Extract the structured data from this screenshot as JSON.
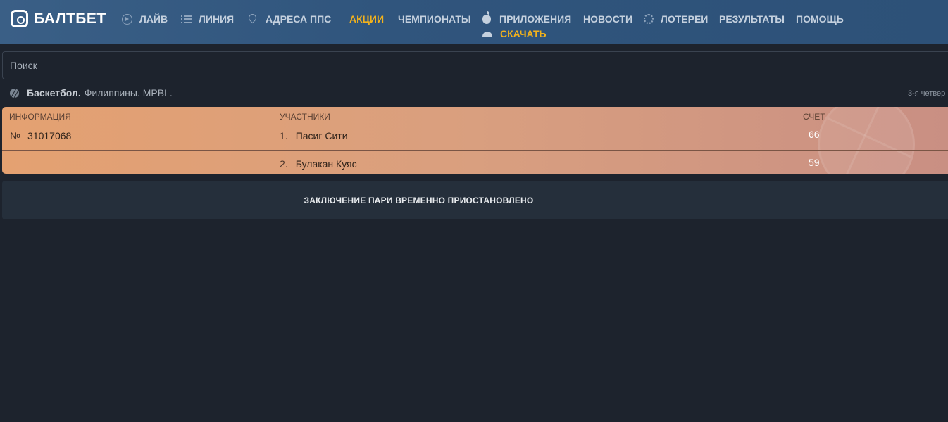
{
  "header": {
    "logo_text": "БАЛТБЕТ",
    "nav": {
      "live": "ЛАЙВ",
      "line": "ЛИНИЯ",
      "addresses": "АДРЕСА ППС",
      "promo": "АКЦИИ",
      "championships": "ЧЕМПИОНАТЫ",
      "apps": "ПРИЛОЖЕНИЯ",
      "download": "СКАЧАТЬ",
      "news": "НОВОСТИ",
      "lotteries": "ЛОТЕРЕИ",
      "results": "РЕЗУЛЬТАТЫ",
      "help": "ПОМОЩЬ"
    },
    "accent_color": "#f2b21c"
  },
  "search": {
    "placeholder": "Поиск",
    "value": ""
  },
  "breadcrumb": {
    "sport": "Баскетбол.",
    "path": "Филиппины. MPBL.",
    "period": "3-я четвер"
  },
  "match": {
    "headers": {
      "info": "ИНФОРМАЦИЯ",
      "participants": "УЧАСТНИКИ",
      "score": "СЧЕТ"
    },
    "number_sign": "№",
    "number": "31017068",
    "teams": [
      {
        "index": "1.",
        "name": "Пасиг Сити",
        "score": "66"
      },
      {
        "index": "2.",
        "name": "Булакан Куяс",
        "score": "59"
      }
    ]
  },
  "status": {
    "message": "ЗАКЛЮЧЕНИЕ ПАРИ ВРЕМЕННО ПРИОСТАНОВЛЕНО"
  }
}
